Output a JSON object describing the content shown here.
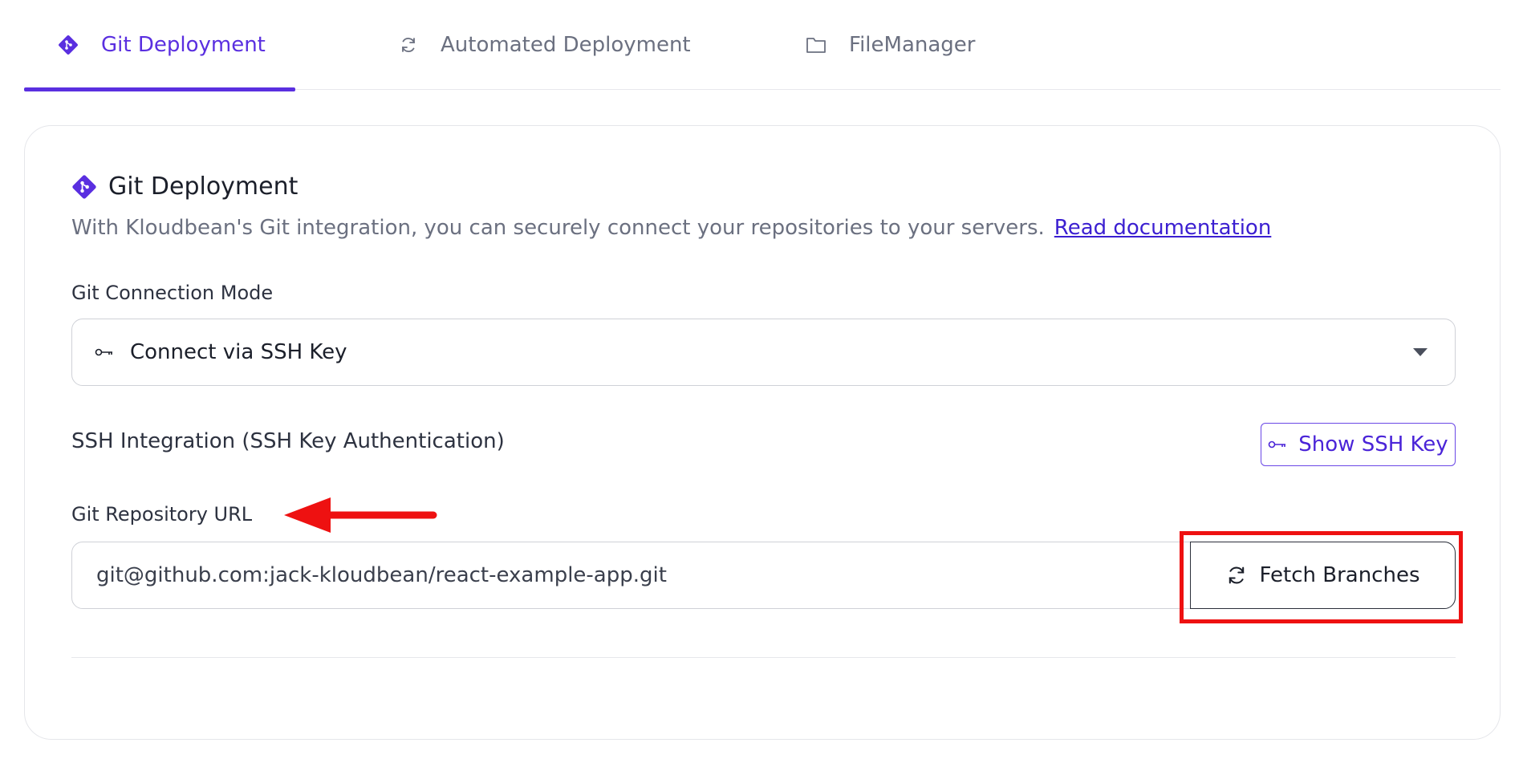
{
  "tabs": [
    {
      "label": "Git Deployment",
      "icon": "git-diamond-icon",
      "active": true
    },
    {
      "label": "Automated Deployment",
      "icon": "refresh-icon",
      "active": false
    },
    {
      "label": "FileManager",
      "icon": "folder-icon",
      "active": false
    }
  ],
  "section": {
    "title": "Git Deployment",
    "description": "With Kloudbean's Git integration, you can securely connect your repositories to your servers.",
    "doc_link": "Read documentation"
  },
  "connection_mode": {
    "label": "Git Connection Mode",
    "selected": "Connect via SSH Key"
  },
  "ssh": {
    "label": "SSH Integration (SSH Key Authentication)",
    "show_key_button": "Show SSH Key"
  },
  "repo": {
    "label": "Git Repository URL",
    "value": "git@github.com:jack-kloudbean/react-example-app.git",
    "fetch_button": "Fetch Branches"
  },
  "colors": {
    "accent": "#5a2fe0",
    "annotation": "#ee1111"
  }
}
